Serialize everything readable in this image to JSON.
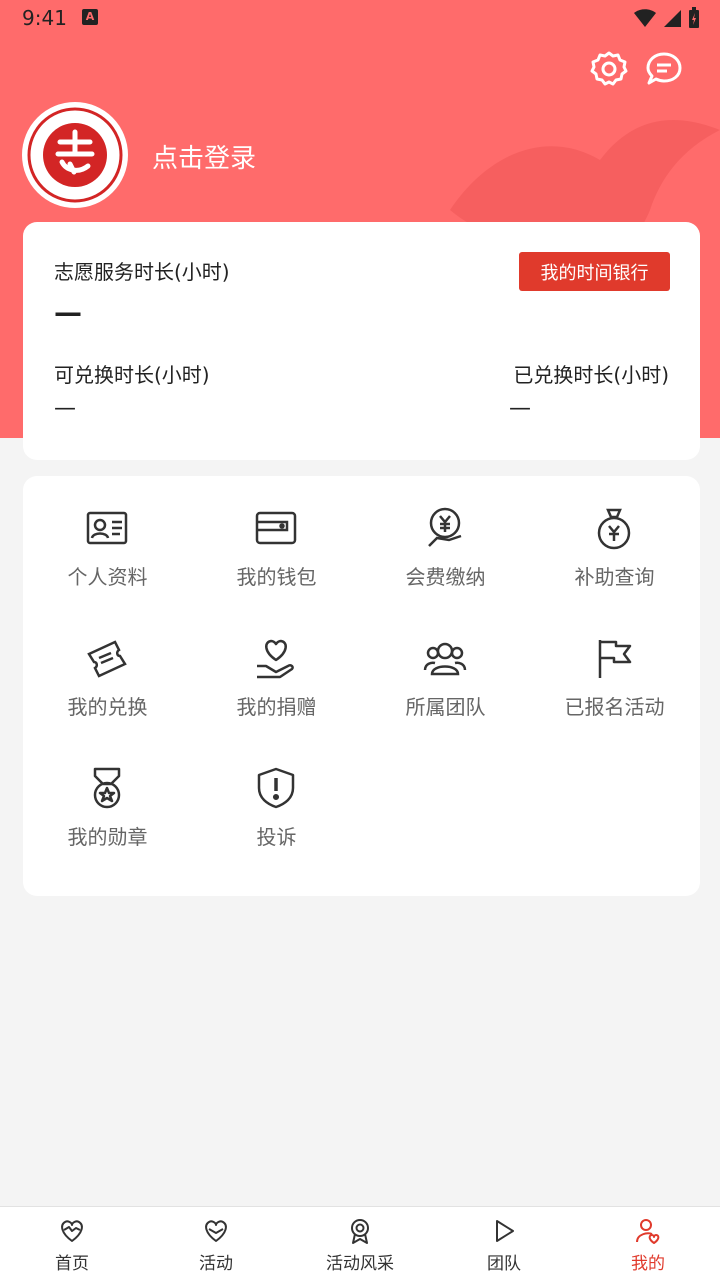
{
  "status_bar": {
    "time": "9:41",
    "app_badge": "A"
  },
  "colors": {
    "primary": "#ff6b6b",
    "accent": "#e03a2c",
    "active_nav": "#e03a2c"
  },
  "header": {
    "login_text": "点击登录",
    "avatar_icon": "china-volunteer-logo",
    "settings_icon": "gear-icon",
    "message_icon": "message-icon"
  },
  "hours_card": {
    "service_label": "志愿服务时长(小时)",
    "service_value": "—",
    "time_bank_button": "我的时间银行",
    "exchangeable_label": "可兑换时长(小时)",
    "exchangeable_value": "—",
    "exchanged_label": "已兑换时长(小时)",
    "exchanged_value": "—"
  },
  "menu": [
    {
      "label": "个人资料",
      "icon": "id-card-icon"
    },
    {
      "label": "我的钱包",
      "icon": "wallet-icon"
    },
    {
      "label": "会费缴纳",
      "icon": "yuan-payment-icon"
    },
    {
      "label": "补助查询",
      "icon": "money-bag-icon"
    },
    {
      "label": "我的兑换",
      "icon": "ticket-icon"
    },
    {
      "label": "我的捐赠",
      "icon": "donate-heart-icon"
    },
    {
      "label": "所属团队",
      "icon": "team-icon"
    },
    {
      "label": "已报名活动",
      "icon": "flag-icon"
    },
    {
      "label": "我的勋章",
      "icon": "medal-icon"
    },
    {
      "label": "投诉",
      "icon": "shield-alert-icon"
    }
  ],
  "bottom_nav": [
    {
      "label": "首页",
      "icon": "heart-home-icon",
      "active": false
    },
    {
      "label": "活动",
      "icon": "handshake-heart-icon",
      "active": false
    },
    {
      "label": "活动风采",
      "icon": "award-icon",
      "active": false
    },
    {
      "label": "团队",
      "icon": "play-icon",
      "active": false
    },
    {
      "label": "我的",
      "icon": "user-heart-icon",
      "active": true
    }
  ]
}
